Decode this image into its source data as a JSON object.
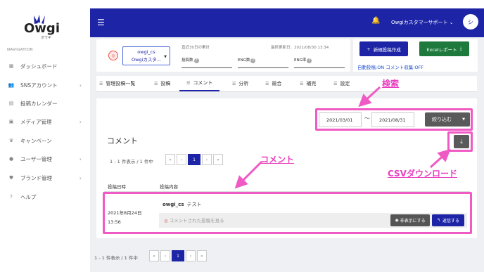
{
  "sidebar": {
    "logo_text": "Owgi",
    "logo_sub": "オウギ",
    "nav_label": "NAVIGATION",
    "items": [
      {
        "label": "ダッシュボード",
        "icon": "grid-icon",
        "chevron": false
      },
      {
        "label": "SNSアカウント",
        "icon": "users-icon",
        "chevron": true
      },
      {
        "label": "投稿カレンダー",
        "icon": "calendar-icon",
        "chevron": false
      },
      {
        "label": "メディア管理",
        "icon": "media-icon",
        "chevron": true
      },
      {
        "label": "キャンペーン",
        "icon": "trophy-icon",
        "chevron": false
      },
      {
        "label": "ユーザー管理",
        "icon": "user-icon",
        "chevron": true
      },
      {
        "label": "ブランド管理",
        "icon": "shield-icon",
        "chevron": true
      },
      {
        "label": "ヘルプ",
        "icon": "help-icon",
        "chevron": false
      }
    ]
  },
  "topbar": {
    "user_name": "Owgiカスタマーサポート",
    "avatar_initial": "シ"
  },
  "account": {
    "handle": "owgi_cs",
    "name": "Owgiカスタ...",
    "period_label": "直近30日の累計",
    "updated": "最終更新日：2021/08/30 13:34",
    "stats": [
      "投稿数",
      "ENG数",
      "ENG率"
    ],
    "new_post_label": "新規投稿作成",
    "excel_label": "Excelレポート",
    "auto_post": "自動投稿:ON",
    "comment_collect": "コメント収集:OFF"
  },
  "tabs": [
    {
      "label": "管理投稿一覧",
      "active": false
    },
    {
      "label": "投稿",
      "active": false
    },
    {
      "label": "コメント",
      "active": true
    },
    {
      "label": "分析",
      "active": false
    },
    {
      "label": "競合",
      "active": false
    },
    {
      "label": "補完",
      "active": false
    },
    {
      "label": "設定",
      "active": false
    }
  ],
  "filter": {
    "date_from": "2021/03/01",
    "tilde": "～",
    "date_to": "2021/08/31",
    "button_label": "絞り込む"
  },
  "comments": {
    "heading": "コメント",
    "pager_info": "1 - 1 件表示 / 1 件中",
    "pager": [
      "«",
      "‹",
      "1",
      "›",
      "»"
    ],
    "col_date": "投稿日時",
    "col_content": "投稿内容",
    "row": {
      "date": "2021年8月24日",
      "time": "13:56",
      "user": "owgi_cs",
      "text": "テスト",
      "view_link": "コメントされた投稿を見る",
      "hide_label": "非表示にする",
      "reply_label": "返信する"
    },
    "footer_pager_info": "1 - 1 件表示 / 1 件中"
  },
  "annotations": {
    "search": "検索",
    "comment": "コメント",
    "csv": "CSVダウンロード"
  },
  "colors": {
    "primary": "#1d24a6",
    "excel": "#1e7a3c",
    "highlight": "#f05ac4"
  }
}
